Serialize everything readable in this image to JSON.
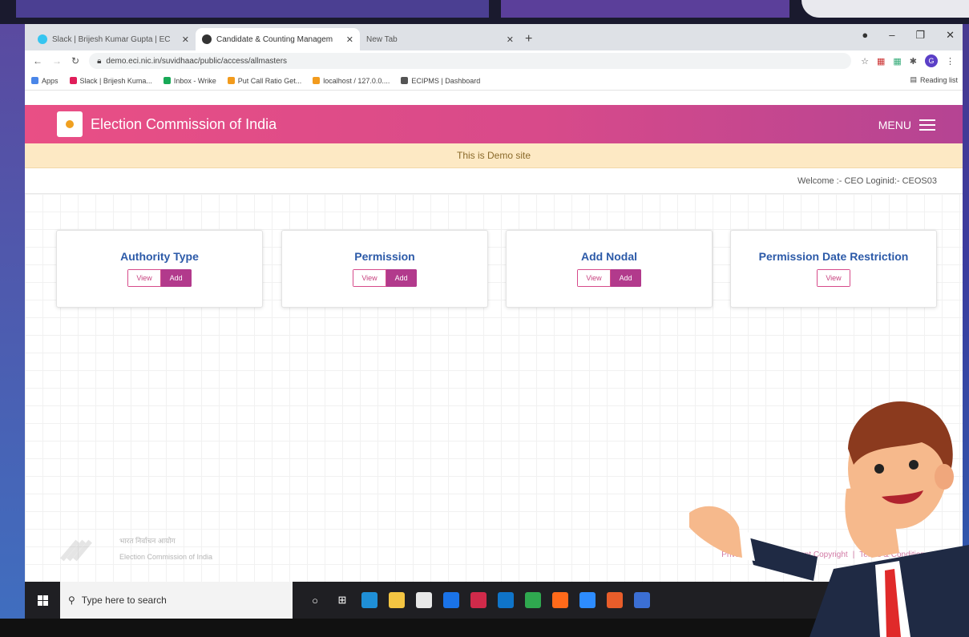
{
  "browser": {
    "tabs": [
      {
        "title": "Slack | Brijesh Kumar Gupta | EC",
        "active": false,
        "favicon_color": "#36c5f0"
      },
      {
        "title": "Candidate & Counting Managem",
        "active": true,
        "favicon_color": "#333333"
      },
      {
        "title": "New Tab",
        "active": false,
        "favicon_color": "#dee1e6"
      }
    ],
    "url": "demo.eci.nic.in/suvidhaac/public/access/allmasters",
    "avatar_letter": "G",
    "bookmarks": [
      {
        "label": "Apps",
        "color": "#4a86e8"
      },
      {
        "label": "Slack | Brijesh Kuma...",
        "color": "#e01e5a"
      },
      {
        "label": "Inbox - Wrike",
        "color": "#18a957"
      },
      {
        "label": "Put Call Ratio Get...",
        "color": "#f29b1d"
      },
      {
        "label": "localhost / 127.0.0....",
        "color": "#f29b1d"
      },
      {
        "label": "ECIPMS | Dashboard",
        "color": "#555555"
      }
    ],
    "reading_list": "Reading list"
  },
  "site": {
    "title": "Election Commission of India",
    "menu_label": "MENU",
    "demo_banner": "This is Demo site",
    "welcome": "Welcome :- CEO Loginid:- CEOS03",
    "accent": "#d84a8a",
    "cards": [
      {
        "title": "Authority Type",
        "view": "View",
        "add": "Add"
      },
      {
        "title": "Permission",
        "view": "View",
        "add": "Add"
      },
      {
        "title": "Add Nodal",
        "view": "View",
        "add": "Add"
      },
      {
        "title": "Permission Date Restriction",
        "view": "View"
      }
    ],
    "footer": {
      "line1": "भारत निर्वाचन आयोग",
      "line2": "Election Commission of India",
      "links": [
        "Privacy Policy",
        "|",
        "Content Copyright",
        "|",
        "Terms & Conditions"
      ]
    }
  },
  "taskbar": {
    "search_placeholder": "Type here to search",
    "apps": [
      {
        "name": "cortana-icon",
        "color": "transparent",
        "glyph": "○"
      },
      {
        "name": "task-view-icon",
        "color": "transparent",
        "glyph": "⊞"
      },
      {
        "name": "edge-icon",
        "color": "#1f8fd6",
        "glyph": ""
      },
      {
        "name": "file-explorer-icon",
        "color": "#f4c542",
        "glyph": ""
      },
      {
        "name": "store-icon",
        "color": "#e8e8e8",
        "glyph": ""
      },
      {
        "name": "app-blue-icon",
        "color": "#1a73e8",
        "glyph": ""
      },
      {
        "name": "app-red-icon",
        "color": "#d02a4a",
        "glyph": ""
      },
      {
        "name": "mail-icon",
        "color": "#0f74c9",
        "glyph": ""
      },
      {
        "name": "chrome-icon",
        "color": "#2fa84f",
        "glyph": ""
      },
      {
        "name": "firefox-icon",
        "color": "#ff6a1a",
        "glyph": ""
      },
      {
        "name": "zoom-icon",
        "color": "#2d8cff",
        "glyph": ""
      },
      {
        "name": "app-orange-icon",
        "color": "#e85d2a",
        "glyph": ""
      },
      {
        "name": "app-doc-icon",
        "color": "#3b6fd4",
        "glyph": ""
      }
    ]
  }
}
